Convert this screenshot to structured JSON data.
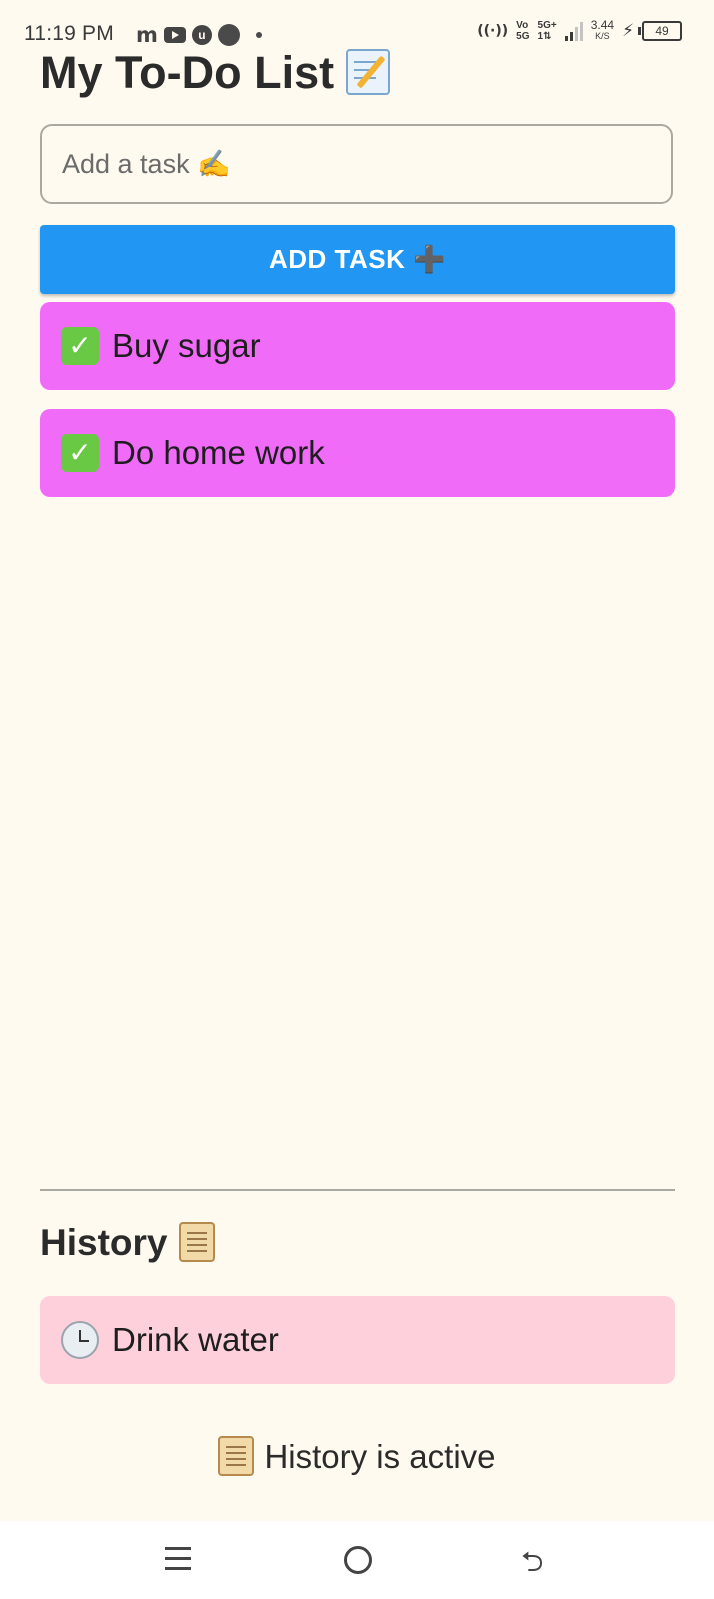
{
  "status_bar": {
    "time": "11:19 PM",
    "notification_m": "m",
    "notification_u": "u",
    "network_volte_top": "Vo",
    "network_volte_bottom": "5G",
    "network_type_top": "5G+",
    "network_type_bottom": "1⇅",
    "speed_value": "3.44",
    "speed_unit": "K/S",
    "battery_level": "49",
    "hotspot_icon": "hotspot-icon",
    "charging_icon": "bolt-icon"
  },
  "app": {
    "title": "My To-Do List",
    "title_icon": "memo-icon",
    "input": {
      "placeholder": "Add a task ✍️",
      "value": ""
    },
    "add_button_label": "ADD TASK ➕",
    "tasks": [
      {
        "label": "Buy sugar",
        "icon": "check-box-icon"
      },
      {
        "label": "Do home work",
        "icon": "check-box-icon"
      }
    ],
    "history": {
      "title": "History",
      "title_icon": "scroll-icon",
      "items": [
        {
          "label": "Drink water",
          "icon": "clock-icon"
        }
      ],
      "status_text": "History is active",
      "status_icon": "scroll-icon"
    }
  },
  "colors": {
    "background": "#fffaf0",
    "primary_button": "#2196f3",
    "task_card": "#f06cf8",
    "history_card": "#fdd0dc"
  },
  "nav_bar": {
    "menu_icon": "menu-icon",
    "home_icon": "home-icon",
    "back_icon": "back-icon",
    "back_glyph": "⮌"
  }
}
